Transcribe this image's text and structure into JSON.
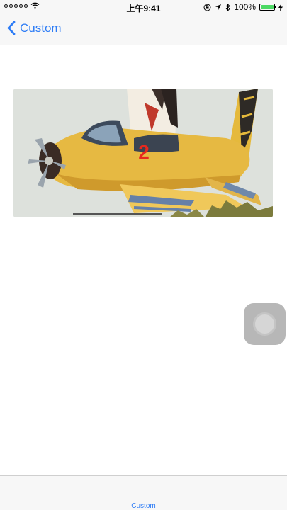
{
  "status_bar": {
    "carrier_dots": 5,
    "time": "上午9:41",
    "battery_percent": "100%",
    "battery_level": 1.0
  },
  "nav": {
    "back_label": "Custom"
  },
  "banner": {
    "page_number": "2"
  },
  "tab_bar": {
    "items": [
      {
        "label": "Custom",
        "selected": true
      }
    ]
  },
  "colors": {
    "accent": "#2d7cf6",
    "page_number": "#e8281e",
    "battery_fill": "#4cd964"
  },
  "icons": {
    "back": "chevron-left-icon",
    "wifi": "wifi-icon",
    "location": "location-arrow-icon",
    "bluetooth": "bluetooth-icon",
    "charging": "charging-bolt-icon",
    "orientation_lock": "orientation-lock-icon"
  }
}
